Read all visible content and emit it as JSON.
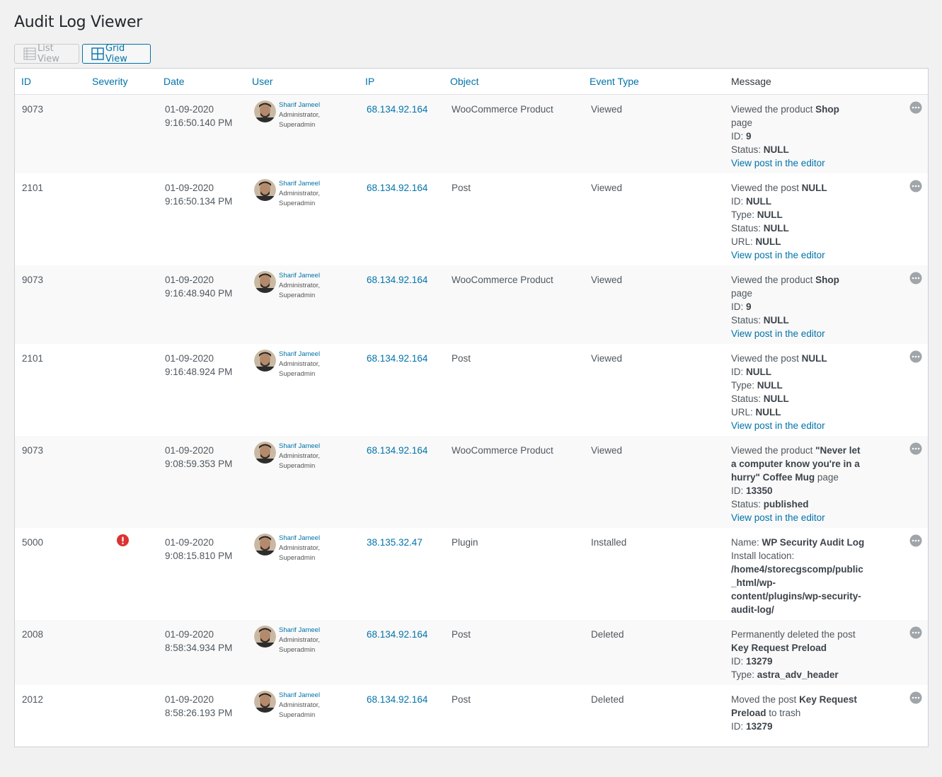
{
  "page": {
    "title": "Audit Log Viewer"
  },
  "view_toggle": {
    "list_label": "List View",
    "grid_label": "Grid View",
    "active": "grid"
  },
  "columns": [
    "ID",
    "Severity",
    "Date",
    "User",
    "IP",
    "Object",
    "Event Type",
    "Message"
  ],
  "colors": {
    "link": "#0073aa",
    "severity_critical": "#dc3232",
    "row_alt": "#f9f9f9"
  },
  "icons": {
    "list": "list-view-icon",
    "grid": "grid-view-icon",
    "severity": "exclamation-icon",
    "more": "more-options-icon"
  },
  "rows": [
    {
      "id": "9073",
      "severity": "",
      "date": "01-09-2020",
      "time": "9:16:50.140 PM",
      "user": {
        "name": "Sharif Jameel",
        "role1": "Administrator,",
        "role2": "Superadmin"
      },
      "ip": "68.134.92.164",
      "object": "WooCommerce Product",
      "event": "Viewed",
      "message": {
        "l1": "Viewed the product ",
        "l1b": "Shop",
        "l2": "page",
        "l3": "ID: ",
        "l3b": "9",
        "l4": "Status: ",
        "l4b": "NULL",
        "link": "View post in the editor"
      }
    },
    {
      "id": "2101",
      "severity": "",
      "date": "01-09-2020",
      "time": "9:16:50.134 PM",
      "user": {
        "name": "Sharif Jameel",
        "role1": "Administrator,",
        "role2": "Superadmin"
      },
      "ip": "68.134.92.164",
      "object": "Post",
      "event": "Viewed",
      "message": {
        "l1": "Viewed the post ",
        "l1b": "NULL",
        "l2": "ID: ",
        "l2b": "NULL",
        "l3": "Type: ",
        "l3b": "NULL",
        "l4": "Status: ",
        "l4b": "NULL",
        "l5": "URL: ",
        "l5b": "NULL",
        "link": "View post in the editor"
      }
    },
    {
      "id": "9073",
      "severity": "",
      "date": "01-09-2020",
      "time": "9:16:48.940 PM",
      "user": {
        "name": "Sharif Jameel",
        "role1": "Administrator,",
        "role2": "Superadmin"
      },
      "ip": "68.134.92.164",
      "object": "WooCommerce Product",
      "event": "Viewed",
      "message": {
        "l1": "Viewed the product ",
        "l1b": "Shop",
        "l2": "page",
        "l3": "ID: ",
        "l3b": "9",
        "l4": "Status: ",
        "l4b": "NULL",
        "link": "View post in the editor"
      }
    },
    {
      "id": "2101",
      "severity": "",
      "date": "01-09-2020",
      "time": "9:16:48.924 PM",
      "user": {
        "name": "Sharif Jameel",
        "role1": "Administrator,",
        "role2": "Superadmin"
      },
      "ip": "68.134.92.164",
      "object": "Post",
      "event": "Viewed",
      "message": {
        "l1": "Viewed the post ",
        "l1b": "NULL",
        "l2": "ID: ",
        "l2b": "NULL",
        "l3": "Type: ",
        "l3b": "NULL",
        "l4": "Status: ",
        "l4b": "NULL",
        "l5": "URL: ",
        "l5b": "NULL",
        "link": "View post in the editor"
      }
    },
    {
      "id": "9073",
      "severity": "",
      "date": "01-09-2020",
      "time": "9:08:59.353 PM",
      "user": {
        "name": "Sharif Jameel",
        "role1": "Administrator,",
        "role2": "Superadmin"
      },
      "ip": "68.134.92.164",
      "object": "WooCommerce Product",
      "event": "Viewed",
      "message": {
        "l1": "Viewed the product ",
        "l1b": "\"Never let",
        "l2b": "a computer know you're in a",
        "l3b": "hurry\" Coffee Mug",
        "l3": " page",
        "l4": "ID: ",
        "l4b": "13350",
        "l5": "Status: ",
        "l5b": "published",
        "link": "View post in the editor"
      }
    },
    {
      "id": "5000",
      "severity": "critical",
      "date": "01-09-2020",
      "time": "9:08:15.810 PM",
      "user": {
        "name": "Sharif Jameel",
        "role1": "Administrator,",
        "role2": "Superadmin"
      },
      "ip": "38.135.32.47",
      "object": "Plugin",
      "event": "Installed",
      "message": {
        "l1": "Name: ",
        "l1b": "WP Security Audit Log",
        "l2": "Install location:",
        "l3b": "/home4/storecgscomp/public",
        "l4b": "_html/wp-",
        "l5b": "content/plugins/wp-security-",
        "l6b": "audit-log/"
      }
    },
    {
      "id": "2008",
      "severity": "",
      "date": "01-09-2020",
      "time": "8:58:34.934 PM",
      "user": {
        "name": "Sharif Jameel",
        "role1": "Administrator,",
        "role2": "Superadmin"
      },
      "ip": "68.134.92.164",
      "object": "Post",
      "event": "Deleted",
      "message": {
        "l1": "Permanently deleted the post",
        "l2b": "Key Request Preload",
        "l3": "ID: ",
        "l3b": "13279",
        "l4": "Type: ",
        "l4b": "astra_adv_header"
      }
    },
    {
      "id": "2012",
      "severity": "",
      "date": "01-09-2020",
      "time": "8:58:26.193 PM",
      "user": {
        "name": "Sharif Jameel",
        "role1": "Administrator,",
        "role2": "Superadmin"
      },
      "ip": "68.134.92.164",
      "object": "Post",
      "event": "Deleted",
      "message": {
        "l1": "Moved the post ",
        "l1b": "Key Request",
        "l2b": "Preload",
        "l2": " to trash",
        "l3": "ID: ",
        "l3b": "13279"
      }
    }
  ]
}
